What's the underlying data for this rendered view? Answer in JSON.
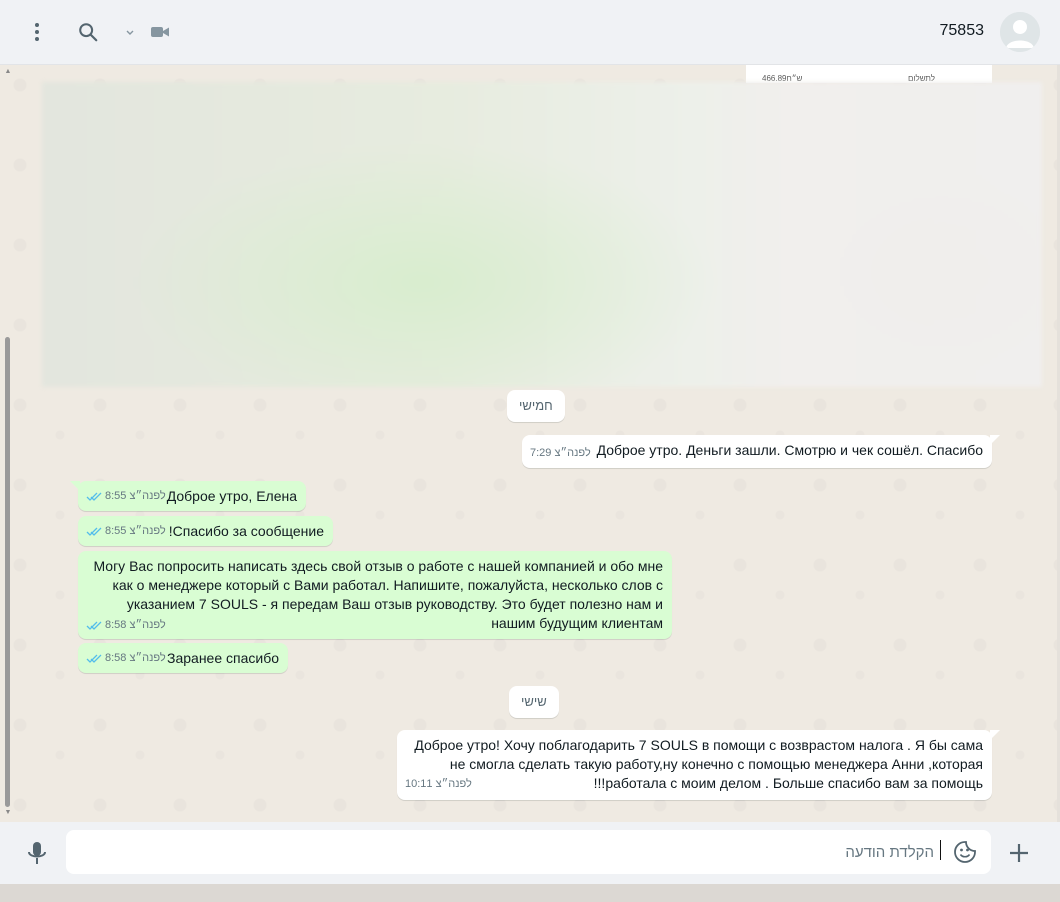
{
  "header": {
    "contact_name": "75853",
    "icons": [
      "menu-icon",
      "search-icon",
      "chevron-down-icon",
      "video-call-icon"
    ]
  },
  "chat": {
    "doc_preview": {
      "left_text": "ש״ח466.89",
      "right_text": "לתשלום"
    },
    "date_chips": [
      "חמישי",
      "שישי"
    ],
    "messages": [
      {
        "direction": "in",
        "text": "Доброе утро. Деньги зашли. Смотрю и чек сошёл. Спасибо",
        "time": "7:29 לפנה״צ"
      },
      {
        "direction": "out",
        "text": "Доброе утро, Елена",
        "time": "8:55 לפנה״צ",
        "status": "read"
      },
      {
        "direction": "out",
        "text": "Спасибо за сообщение!",
        "time": "8:55 לפנה״צ",
        "status": "read"
      },
      {
        "direction": "out",
        "lines": [
          "Могу Вас попросить написать здесь свой отзыв о работе с нашей компанией и обо мне",
          "как о менеджере который с Вами работал. Напишите, пожалуйста, несколько слов с",
          "указанием 7 SOULS - я передам Ваш отзыв руководству. Это будет полезно нам и",
          "нашим будущим клиентам"
        ],
        "time": "8:58 לפנה״צ",
        "status": "read"
      },
      {
        "direction": "out",
        "text": "Заранее спасибо",
        "time": "8:58 לפנה״צ",
        "status": "read"
      },
      {
        "direction": "in",
        "lines": [
          "Доброе утро! Хочу поблагодарить 7 SOULS в помощи с возврастом налога . Я бы сама",
          "не смогла сделать такую работу,ну конечно с помощью менеджера Анни ,которая",
          "работала с моим делом . Больше спасибо вам за помощь!!!"
        ],
        "time": "10:11 לפנה״צ"
      }
    ]
  },
  "composer": {
    "placeholder": "הקלדת הודעה",
    "value": ""
  },
  "colors": {
    "incoming_bubble": "#ffffff",
    "outgoing_bubble": "#d9fdd3",
    "read_tick": "#53bdeb",
    "chat_background": "#efeae2"
  }
}
